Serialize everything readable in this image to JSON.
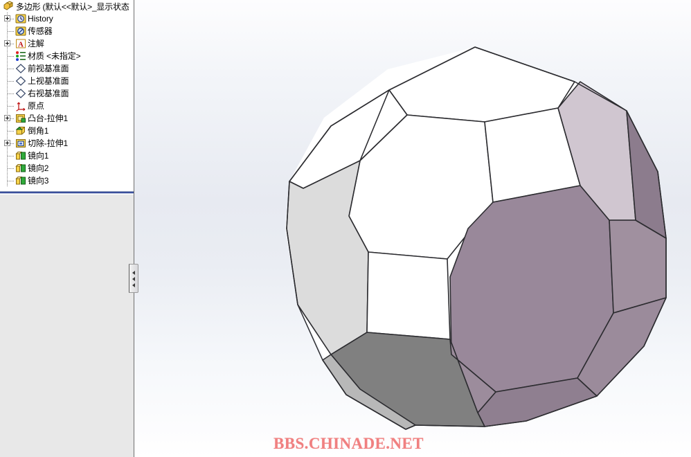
{
  "window": {
    "app": "SolidWorks",
    "viewport_background_top": "#fdfdfe",
    "viewport_background_mid": "#e7eaf1"
  },
  "feature_manager": {
    "title": {
      "label": "多边形  (默认<<默认>_显示状态",
      "icon": "part-document-icon"
    },
    "items": [
      {
        "label": "History",
        "icon": "history-icon",
        "expandable": true,
        "indent": 0
      },
      {
        "label": "传感器",
        "icon": "sensor-icon",
        "expandable": false,
        "indent": 0
      },
      {
        "label": "注解",
        "icon": "annotation-icon",
        "expandable": true,
        "indent": 0
      },
      {
        "label": "材质 <未指定>",
        "icon": "material-icon",
        "expandable": false,
        "indent": 0
      },
      {
        "label": "前视基准面",
        "icon": "plane-icon",
        "expandable": false,
        "indent": 0
      },
      {
        "label": "上视基准面",
        "icon": "plane-icon",
        "expandable": false,
        "indent": 0
      },
      {
        "label": "右视基准面",
        "icon": "plane-icon",
        "expandable": false,
        "indent": 0
      },
      {
        "label": "原点",
        "icon": "origin-icon",
        "expandable": false,
        "indent": 0
      },
      {
        "label": "凸台-拉伸1",
        "icon": "boss-extrude-icon",
        "expandable": true,
        "indent": 0
      },
      {
        "label": "倒角1",
        "icon": "chamfer-icon",
        "expandable": false,
        "indent": 0
      },
      {
        "label": "切除-拉伸1",
        "icon": "cut-extrude-icon",
        "expandable": true,
        "indent": 0
      },
      {
        "label": "镜向1",
        "icon": "mirror-icon",
        "expandable": false,
        "indent": 0
      },
      {
        "label": "镜向2",
        "icon": "mirror-icon",
        "expandable": false,
        "indent": 0
      },
      {
        "label": "镜向3",
        "icon": "mirror-icon",
        "expandable": false,
        "indent": 0
      }
    ],
    "rollback_bar_color": "#2a3f8f",
    "splitter": {
      "name": "panel-splitter",
      "arrows": 3,
      "direction": "left"
    }
  },
  "model": {
    "name": "truncated-polyhedron",
    "edge_color": "#2c2c30",
    "face_colors": {
      "white": "#ffffff",
      "light_gray": "#dcdcdc",
      "mid_gray": "#808080",
      "lavender_light": "#d0c6d0",
      "mauve": "#99889a",
      "mauve_dark": "#8c7c8d",
      "mauve_mid": "#a0909f"
    }
  },
  "watermark": {
    "text": "BBS.CHINADE.NET",
    "color": "#f08080"
  }
}
